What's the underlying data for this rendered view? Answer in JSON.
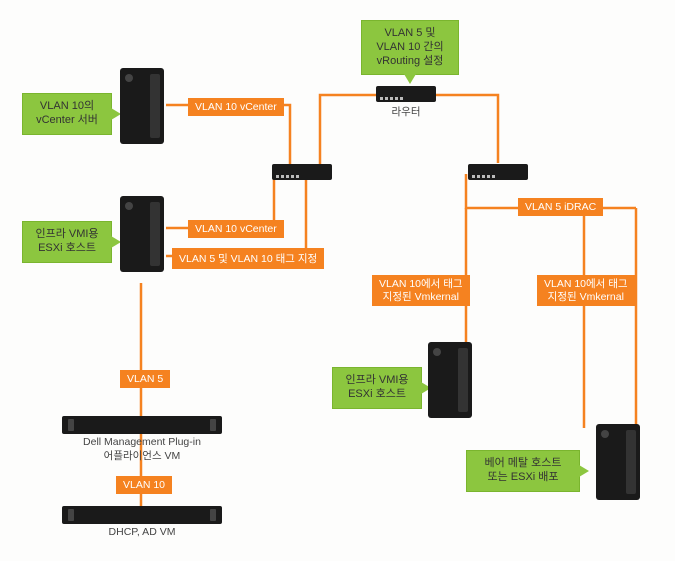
{
  "callouts": {
    "vlan10_vcenter_srv": "VLAN 10의\nvCenter 서버",
    "vrouting": "VLAN 5 및\nVLAN 10 간의\nvRouting 설정",
    "infra_esxi_left": "인프라 VMI용\nESXi 호스트",
    "infra_esxi_right": "인프라 VMI용\nESXi 호스트",
    "bare_metal": "베어 메탈 호스트\n또는 ESXi 배포"
  },
  "labels": {
    "vlan10_vcenter_a": "VLAN 10 vCenter",
    "vlan10_vcenter_b": "VLAN 10 vCenter",
    "vlan5_10_tag": "VLAN 5 및 VLAN 10 태그 지정",
    "vlan5_idrac": "VLAN 5 iDRAC",
    "vlan10_tag_vmk_a": "VLAN 10에서 태그\n지정된 Vmkernal",
    "vlan10_tag_vmk_b": "VLAN 10에서 태그\n지정된 Vmkernal",
    "vlan5": "VLAN 5",
    "vlan10": "VLAN 10"
  },
  "captions": {
    "router": "라우터",
    "plugin": "Dell Management Plug-in\n어플라이언스 VM",
    "dhcp": "DHCP, AD VM"
  }
}
